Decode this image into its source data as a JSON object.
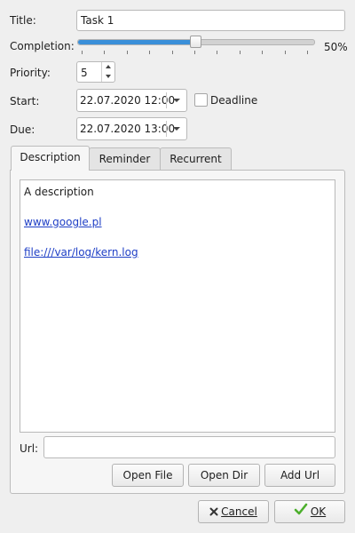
{
  "form": {
    "title_label": "Title:",
    "title_value": "Task 1",
    "completion_label": "Completion:",
    "completion_value": "50%",
    "completion_fraction": 0.5,
    "priority_label": "Priority:",
    "priority_value": "5",
    "start_label": "Start:",
    "start_value": "22.07.2020 12:00",
    "deadline_label": "Deadline",
    "deadline_checked": false,
    "due_label": "Due:",
    "due_value": "22.07.2020 13:00"
  },
  "tabs": [
    {
      "label": "Description",
      "active": true
    },
    {
      "label": "Reminder",
      "active": false
    },
    {
      "label": "Recurrent",
      "active": false
    }
  ],
  "description": {
    "text": "A description",
    "link1": "www.google.pl",
    "link2": "file:///var/log/kern.log"
  },
  "url": {
    "label": "Url:",
    "value": ""
  },
  "buttons": {
    "open_file": "Open File",
    "open_dir": "Open Dir",
    "add_url": "Add Url",
    "cancel": "Cancel",
    "ok": "OK"
  },
  "icons": {
    "cancel": "x-icon",
    "ok": "checkmark-icon"
  },
  "colors": {
    "slider_fill": "#3a8fd9",
    "link": "#1f3fc6",
    "ok_check": "#4caf2c"
  }
}
